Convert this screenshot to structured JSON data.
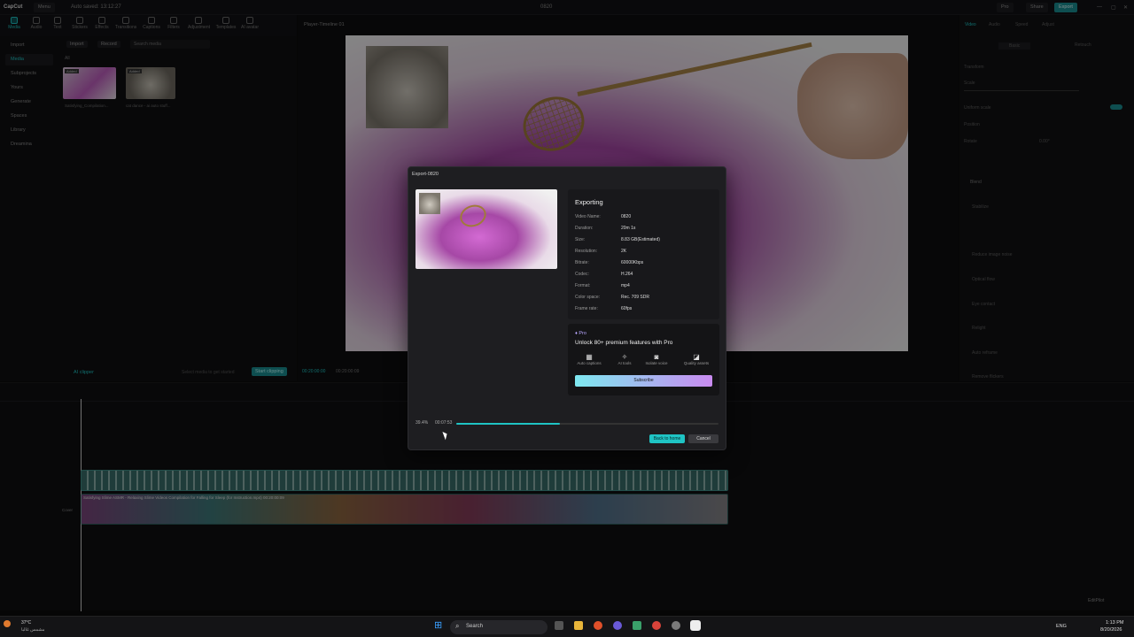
{
  "app": {
    "logo": "CapCut",
    "menu_label": "Menu",
    "autosave": "Auto saved: 13:12:27",
    "window_title": "0820",
    "pro_label": "Pro",
    "share_label": "Share",
    "export_label": "Export"
  },
  "toolbar": [
    {
      "label": "Media",
      "icon": "media-icon"
    },
    {
      "label": "Audio",
      "icon": "audio-icon"
    },
    {
      "label": "Text",
      "icon": "text-icon"
    },
    {
      "label": "Stickers",
      "icon": "sticker-icon"
    },
    {
      "label": "Effects",
      "icon": "effects-icon"
    },
    {
      "label": "Transitions",
      "icon": "transition-icon"
    },
    {
      "label": "Captions",
      "icon": "captions-icon"
    },
    {
      "label": "Filters",
      "icon": "filter-icon"
    },
    {
      "label": "Adjustment",
      "icon": "adjust-icon"
    },
    {
      "label": "Templates",
      "icon": "template-icon"
    },
    {
      "label": "AI avatar",
      "icon": "avatar-icon"
    }
  ],
  "leftnav": [
    "Import",
    "Media",
    "Subprojects",
    "Yours",
    "Generate",
    "Spaces",
    "Library",
    "Dreamina"
  ],
  "media": {
    "import_label": "Import",
    "record_label": "Record",
    "search_placeholder": "Search media",
    "all_label": "All",
    "items": [
      {
        "badge": "Added",
        "caption": "Satisfying_Compilation..."
      },
      {
        "badge": "Added",
        "caption": "cat dance - ai auto stuff..."
      }
    ],
    "ai_clipper": "AI clipper",
    "select_hint": "Select media to get started",
    "start_clipping": "Start clipping"
  },
  "player": {
    "title": "Player-Timeline 01",
    "time_current": "00:20:00:00",
    "time_total": "00:20:00:09"
  },
  "right_panel": {
    "tabs": [
      "Video",
      "Audio",
      "Speed",
      "Adjust"
    ],
    "subtabs": [
      "Basic",
      "Retouch"
    ],
    "rows": [
      "Transform",
      "Scale",
      "Uniform scale",
      "Position",
      "Rotate",
      "Blend",
      "Stabilize",
      "Reduce image noise",
      "Optical flow",
      "Eye contact",
      "Relight",
      "Auto reframe",
      "Remove flickers"
    ],
    "rotate_value": "0.00°"
  },
  "timeline": {
    "cover_label": "Cover",
    "track_caption": "Satisfying Slime ASMR - Relaxing Slime Videos Compilation for Falling for Sleep (for Instruction.mp4) 00:20:00:09"
  },
  "export_dialog": {
    "title": "Export-0820",
    "heading": "Exporting",
    "fields": [
      {
        "key": "Video Name:",
        "value": "0820"
      },
      {
        "key": "Duration:",
        "value": "20m 1s"
      },
      {
        "key": "Size:",
        "value": "8.83 GB(Estimated)"
      },
      {
        "key": "Resolution:",
        "value": "2K"
      },
      {
        "key": "Bitrate:",
        "value": "60000Kbps"
      },
      {
        "key": "Codec:",
        "value": "H.264"
      },
      {
        "key": "Format:",
        "value": "mp4"
      },
      {
        "key": "Color space:",
        "value": "Rec. 709 SDR"
      },
      {
        "key": "Frame rate:",
        "value": "60fps"
      }
    ],
    "pro_badge": "Pro",
    "promo_heading": "Unlock 80+ premium features with Pro",
    "features": [
      {
        "label": "Auto captions",
        "icon": "captions-icon"
      },
      {
        "label": "AI tools",
        "icon": "ai-tools-icon"
      },
      {
        "label": "Isolate voice",
        "icon": "voice-icon"
      },
      {
        "label": "Quality assets",
        "icon": "assets-icon"
      }
    ],
    "subscribe_label": "Subscribe",
    "progress_percent_label": "39.4%",
    "progress_fraction": 0.394,
    "elapsed": "00:07:53",
    "back_label": "Back to home",
    "cancel_label": "Cancel"
  },
  "taskbar": {
    "weather_temp": "37°C",
    "weather_desc": "مشمس غالبا",
    "search_label": "Search",
    "lang": "ENG",
    "time": "1:13 PM",
    "date": "8/20/2026"
  },
  "editpilot": "EditPilot",
  "colors": {
    "accent": "#1fc4c4",
    "pro_gradient_start": "#7ee8f0",
    "pro_gradient_end": "#c98bf0"
  }
}
